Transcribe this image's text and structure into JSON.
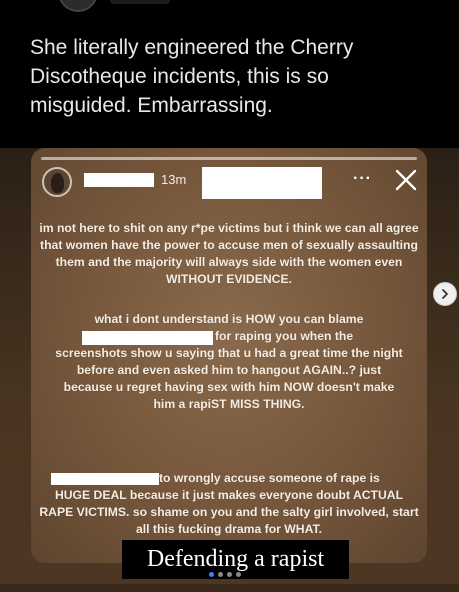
{
  "post": {
    "caption": "She literally engineered the Cherry Discotheque incidents, this is so misguided. Embarrassing."
  },
  "story": {
    "timestamp": "13m",
    "more_label": "···",
    "text": {
      "p1": "im not here to shit on any r*pe victims but i think we can all agree that women have the power to accuse men of sexually assaulting them and the majority will always side with the women even WITHOUT EVIDENCE.",
      "p2_line1": "what i dont understand is HOW you can blame",
      "p2_line2": "for raping you when the",
      "p2_rest": "screenshots show u saying that u had a great time the night before and even asked him to hangout AGAIN..? just because u regret having sex with him NOW doesn't make him a rapiST MISS THING.",
      "p3_line1": "to wrongly accuse someone of rape is",
      "p3_rest": "HUGE DEAL because it just makes everyone doubt ACTUAL RAPE VICTIMS. so shame on you and the salty girl involved, start all this fucking drama for WHAT."
    }
  },
  "meme_caption": "Defending a rapist",
  "carousel": {
    "total": 4,
    "active_index": 0
  },
  "icons": {
    "close": "close-icon",
    "next": "chevron-right-icon",
    "more": "more-horizontal-icon"
  },
  "colors": {
    "card": "#7a5a3e",
    "caption_text": "#e8e8e8",
    "active_dot": "#3b82f6"
  }
}
